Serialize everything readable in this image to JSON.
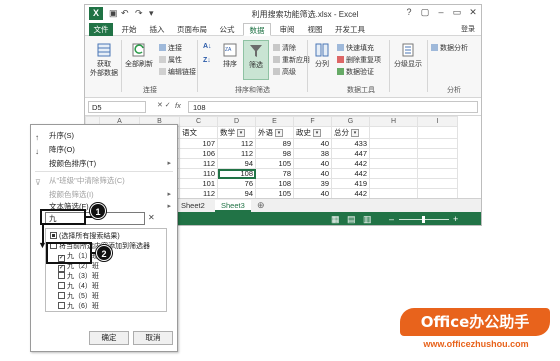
{
  "window": {
    "title": "利用搜索功能筛选.xlsx - Excel",
    "quick_access": [
      "↶",
      "↷",
      "▾"
    ],
    "controls": [
      "?",
      "▢",
      "–",
      "▭",
      "✕"
    ]
  },
  "tabs": [
    {
      "label": "文件"
    },
    {
      "label": "开始"
    },
    {
      "label": "插入"
    },
    {
      "label": "页面布局"
    },
    {
      "label": "公式"
    },
    {
      "label": "数据"
    },
    {
      "label": "审阅"
    },
    {
      "label": "视图"
    },
    {
      "label": "开发工具"
    }
  ],
  "login": "登录",
  "ribbon": {
    "get_external": "获取\n外部数据",
    "refresh_all": "全部刷新",
    "connections": "连接",
    "properties": "属性",
    "edit_links": "编辑链接",
    "group_connections": "连接",
    "sort": "排序",
    "filter": "筛选",
    "clear": "清除",
    "reapply": "重新应用",
    "advanced": "高级",
    "group_sortfilter": "排序和筛选",
    "text_to_columns": "分列",
    "flash_fill": "快速填充",
    "remove_dup": "删除重复项",
    "data_validation": "数据验证",
    "group_datatools": "数据工具",
    "outline": "分级显示",
    "data_analysis": "数据分析",
    "group_analysis": "分析"
  },
  "formula_bar": {
    "name_box": "D5",
    "fx": "fx",
    "value": "108"
  },
  "grid": {
    "columns": [
      "A",
      "B",
      "C",
      "D",
      "E",
      "F",
      "G",
      "H",
      "I"
    ],
    "header_row": {
      "num": "1",
      "cells": [
        "姓名",
        "班级",
        "语文",
        "数学",
        "外语",
        "政史",
        "总分"
      ]
    },
    "rows": [
      {
        "c": "107",
        "d": "112",
        "e": "89",
        "f": "40",
        "g": "433"
      },
      {
        "c": "106",
        "d": "112",
        "e": "98",
        "f": "38",
        "g": "447"
      },
      {
        "c": "112",
        "d": "94",
        "e": "105",
        "f": "40",
        "g": "442"
      },
      {
        "c": "110",
        "d": "108",
        "e": "78",
        "f": "40",
        "g": "442"
      },
      {
        "c": "101",
        "d": "76",
        "e": "108",
        "f": "39",
        "g": "419"
      },
      {
        "c": "112",
        "d": "94",
        "e": "105",
        "f": "40",
        "g": "442"
      },
      {
        "c": "91",
        "d": "78",
        "e": "101",
        "f": "40",
        "g": "406"
      }
    ]
  },
  "sheets": [
    "Sheet2",
    "Sheet3"
  ],
  "filter_menu": {
    "sort_asc": "升序(S)",
    "sort_desc": "降序(O)",
    "sort_color": "按颜色排序(T)",
    "clear_filter": "从\"班级\"中清除筛选(C)",
    "color_filter": "按颜色筛选(I)",
    "text_filter": "文本筛选(F)",
    "search_value": "九",
    "options": [
      {
        "label": "(选择所有搜索结果)",
        "state": "partial"
      },
      {
        "label": "将当前所选内容添加到筛选器",
        "state": "unchecked"
      },
      {
        "label": "九（1）班",
        "state": "checked"
      },
      {
        "label": "九（2）班",
        "state": "checked"
      },
      {
        "label": "九（3）班",
        "state": "unchecked"
      },
      {
        "label": "九（4）班",
        "state": "unchecked"
      },
      {
        "label": "九（5）班",
        "state": "unchecked"
      },
      {
        "label": "九（6）班",
        "state": "unchecked"
      }
    ],
    "ok": "确定",
    "cancel": "取消"
  },
  "callouts": [
    "1",
    "2"
  ],
  "brand": {
    "name": "Office办公助手",
    "url": "www.officezhushou.com",
    "color": "#e8631c"
  },
  "colors": {
    "excel_green": "#217346"
  }
}
